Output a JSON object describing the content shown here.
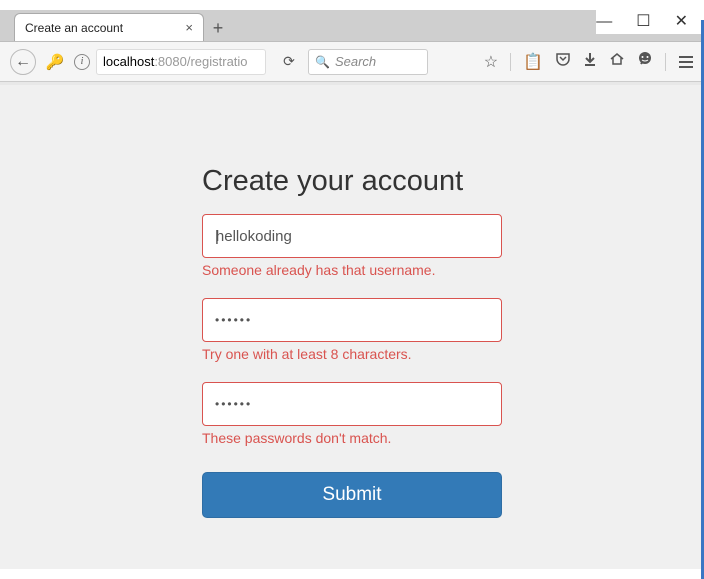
{
  "window": {
    "minimize": "—",
    "maximize": "☐",
    "close": "✕"
  },
  "tab": {
    "title": "Create an account",
    "close": "×",
    "new": "+"
  },
  "toolbar": {
    "back": "←",
    "key": "🔑",
    "info": "i",
    "url_host": "localhost",
    "url_rest": ":8080/registratio",
    "reload": "⟳",
    "search_placeholder": "Search",
    "star": "☆",
    "clipboard": "📋",
    "pocket": "⌄",
    "download": "↓",
    "home": "⌂",
    "chat": "☻",
    "menu": "≡"
  },
  "form": {
    "title": "Create your account",
    "username_value": "hellokoding",
    "username_error": "Someone already has that username.",
    "password_dots": "••••••",
    "password_error": "Try one with at least 8 characters.",
    "confirm_dots": "••••••",
    "confirm_error": "These passwords don't match.",
    "submit_label": "Submit"
  }
}
